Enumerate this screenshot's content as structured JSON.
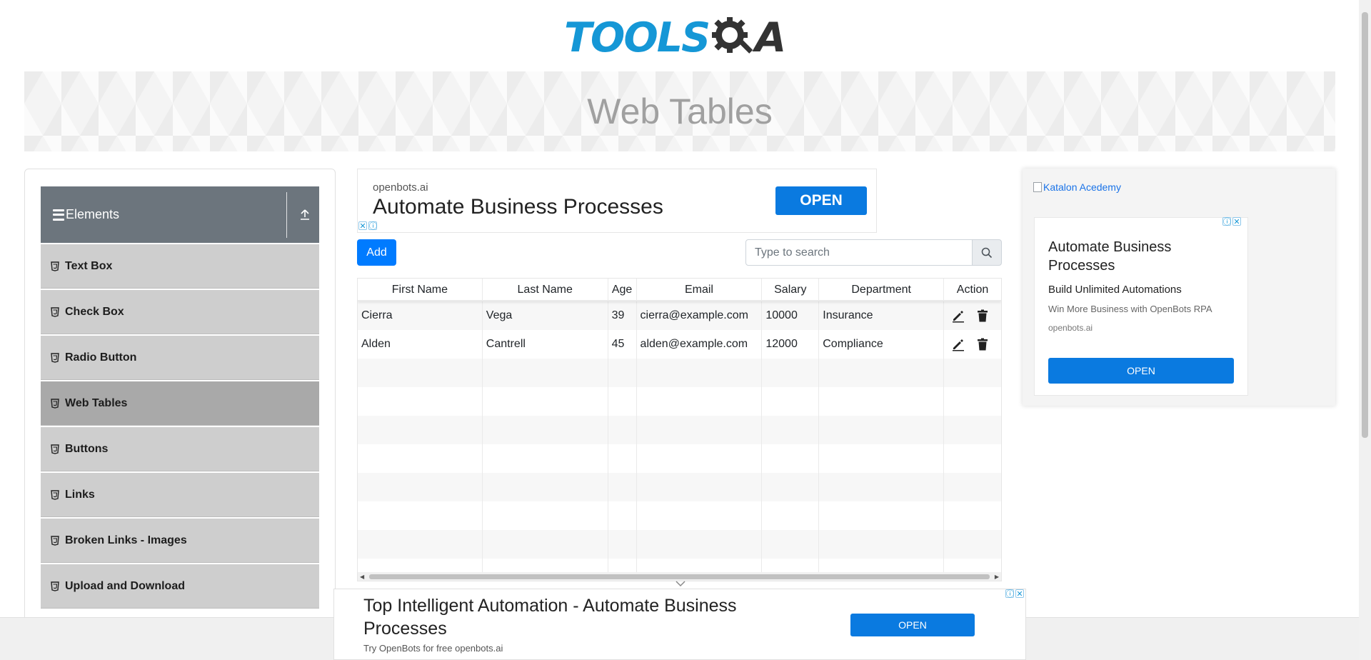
{
  "header": {
    "logo_left": "TOOLS",
    "logo_right": "A"
  },
  "banner": {
    "title": "Web Tables"
  },
  "sidebar": {
    "group_title": "Elements",
    "items": [
      {
        "label": "Text Box"
      },
      {
        "label": "Check Box"
      },
      {
        "label": "Radio Button"
      },
      {
        "label": "Web Tables",
        "active": true
      },
      {
        "label": "Buttons"
      },
      {
        "label": "Links"
      },
      {
        "label": "Broken Links - Images"
      },
      {
        "label": "Upload and Download"
      }
    ]
  },
  "ad_top": {
    "domain": "openbots.ai",
    "title": "Automate Business Processes",
    "button": "OPEN"
  },
  "toolbar": {
    "add_label": "Add",
    "search_placeholder": "Type to search"
  },
  "table": {
    "headers": [
      "First Name",
      "Last Name",
      "Age",
      "Email",
      "Salary",
      "Department",
      "Action"
    ],
    "rows": [
      [
        "Cierra",
        "Vega",
        "39",
        "cierra@example.com",
        "10000",
        "Insurance"
      ],
      [
        "Alden",
        "Cantrell",
        "45",
        "alden@example.com",
        "12000",
        "Compliance"
      ]
    ],
    "empty_rows": 8
  },
  "right_ad": {
    "image_alt": "Katalon Acedemy",
    "title": "Automate Business Processes",
    "subtitle": "Build Unlimited Automations",
    "description": "Win More Business with OpenBots RPA",
    "domain": "openbots.ai",
    "button": "OPEN"
  },
  "bottom_ad": {
    "title": "Top Intelligent Automation - Automate Business Processes",
    "subtitle": "Try OpenBots for free openbots.ai",
    "button": "OPEN"
  },
  "colors": {
    "primary": "#007bff",
    "logo_blue": "#1597d6",
    "sidebar_header": "#6c757d",
    "sidebar_item": "#cecece",
    "sidebar_active": "#a9a9a9"
  }
}
